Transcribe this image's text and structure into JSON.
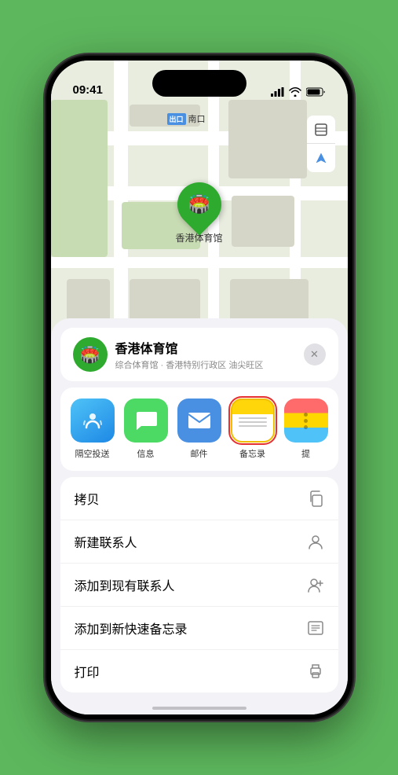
{
  "status_bar": {
    "time": "09:41",
    "location_arrow": "▲"
  },
  "map": {
    "label_badge": "出口",
    "label_text": "南口",
    "stadium_label": "香港体育馆",
    "stadium_emoji": "🏟️"
  },
  "map_controls": {
    "layers_icon": "🗺",
    "location_icon": "⬆"
  },
  "location_card": {
    "icon": "🏟️",
    "name": "香港体育馆",
    "subtitle": "综合体育馆 · 香港特别行政区 油尖旺区",
    "close": "✕"
  },
  "share_items": [
    {
      "id": "airdrop",
      "label": "隔空投送",
      "type": "airdrop"
    },
    {
      "id": "message",
      "label": "信息",
      "type": "message"
    },
    {
      "id": "mail",
      "label": "邮件",
      "type": "mail"
    },
    {
      "id": "notes",
      "label": "备忘录",
      "type": "notes",
      "highlighted": true
    },
    {
      "id": "more",
      "label": "提",
      "type": "more"
    }
  ],
  "action_items": [
    {
      "id": "copy",
      "label": "拷贝",
      "icon": "⎘"
    },
    {
      "id": "new-contact",
      "label": "新建联系人",
      "icon": "👤"
    },
    {
      "id": "add-contact",
      "label": "添加到现有联系人",
      "icon": "👤"
    },
    {
      "id": "quick-note",
      "label": "添加到新快速备忘录",
      "icon": "⊞"
    },
    {
      "id": "print",
      "label": "打印",
      "icon": "🖨"
    }
  ]
}
